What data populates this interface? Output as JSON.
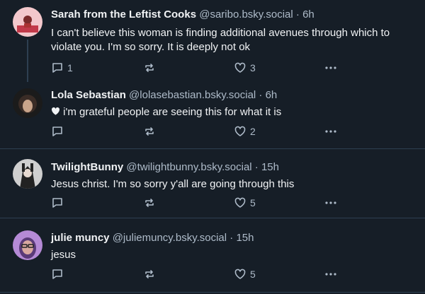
{
  "posts": [
    {
      "author": "Sarah from the Leftist Cooks",
      "handle": "@saribo.bsky.social",
      "time": "6h",
      "text": "I can't believe this woman is finding additional avenues through which to violate you. I'm so sorry. It is deeply not ok",
      "reply_count": "1",
      "like_count": "3"
    },
    {
      "author": "Lola Sebastian",
      "handle": "@lolasebastian.bsky.social",
      "time": "6h",
      "text": "i'm grateful people are seeing this for what it is",
      "reply_count": "",
      "like_count": "2"
    },
    {
      "author": "TwilightBunny",
      "handle": "@twilightbunny.bsky.social",
      "time": "15h",
      "text": "Jesus christ. I'm so sorry y'all are going through this",
      "reply_count": "",
      "like_count": "5"
    },
    {
      "author": "julie muncy",
      "handle": "@juliemuncy.bsky.social",
      "time": "15h",
      "text": "jesus",
      "reply_count": "",
      "like_count": "5"
    }
  ],
  "separator": " · ",
  "colors": {
    "background": "#161e27",
    "text": "#f1f3f5",
    "muted": "#aebbc9",
    "border": "#2e3f51"
  },
  "icons": {
    "reply": "speech-bubble-icon",
    "repost": "repost-arrows-icon",
    "like": "heart-outline-icon",
    "more": "ellipsis-icon",
    "inline": "heart-filled-icon"
  }
}
